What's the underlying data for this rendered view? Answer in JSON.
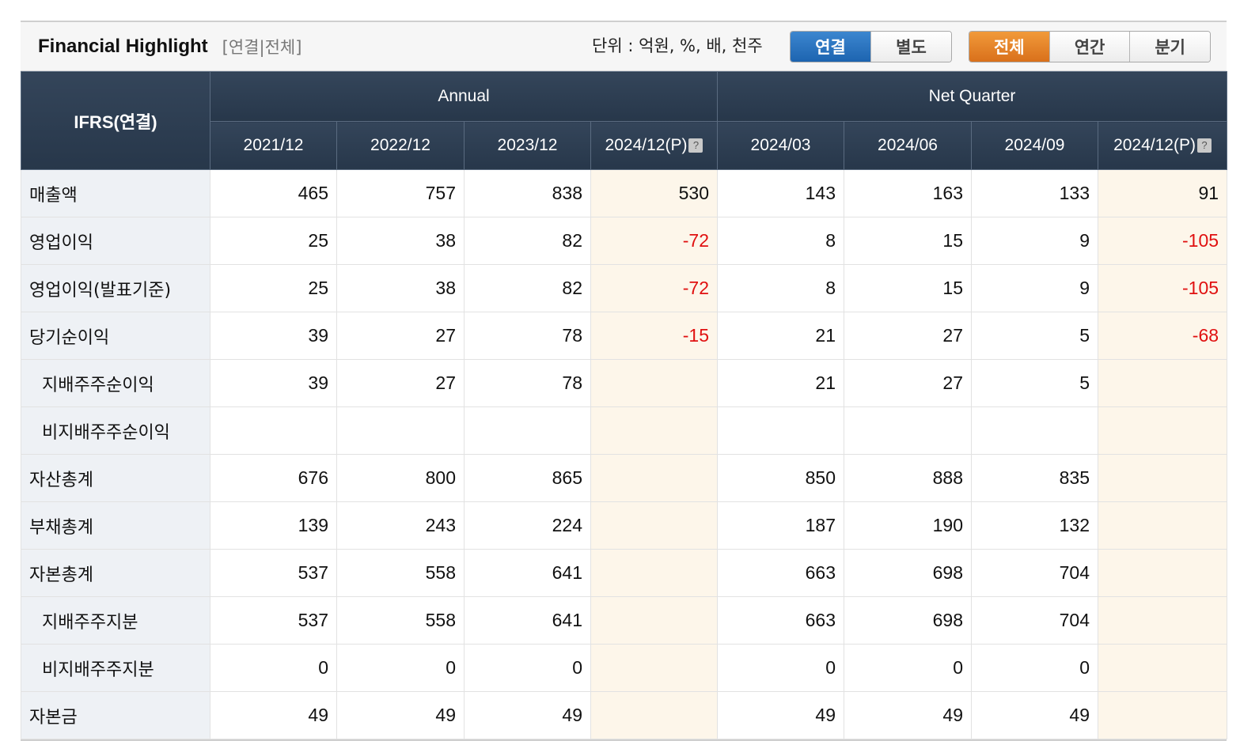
{
  "header": {
    "title": "Financial Highlight",
    "subtitle": "[연결|전체]",
    "unit_label": "단위 : 억원, %, 배, 천주",
    "consolidation_buttons": [
      "연결",
      "별도"
    ],
    "period_buttons": [
      "전체",
      "연간",
      "분기"
    ],
    "active_consolidation": "연결",
    "active_period": "전체",
    "colors": {
      "active_blue": "#1d64b0",
      "active_orange": "#d9701b",
      "header_bg": "#2c3d52",
      "negative": "#e01010",
      "estimate_bg": "#fdf6ea"
    }
  },
  "table": {
    "corner_label": "IFRS(연결)",
    "group_labels": [
      "Annual",
      "Net Quarter"
    ],
    "columns": [
      "2021/12",
      "2022/12",
      "2023/12",
      "2024/12(P)",
      "2024/03",
      "2024/06",
      "2024/09",
      "2024/12(P)"
    ],
    "help_icon": "?",
    "rows": [
      {
        "label": "매출액",
        "values": [
          "465",
          "757",
          "838",
          "530",
          "143",
          "163",
          "133",
          "91"
        ]
      },
      {
        "label": "영업이익",
        "values": [
          "25",
          "38",
          "82",
          "-72",
          "8",
          "15",
          "9",
          "-105"
        ]
      },
      {
        "label": "영업이익(발표기준)",
        "values": [
          "25",
          "38",
          "82",
          "-72",
          "8",
          "15",
          "9",
          "-105"
        ]
      },
      {
        "label": "당기순이익",
        "values": [
          "39",
          "27",
          "78",
          "-15",
          "21",
          "27",
          "5",
          "-68"
        ]
      },
      {
        "label": "지배주주순이익",
        "values": [
          "39",
          "27",
          "78",
          "",
          "21",
          "27",
          "5",
          ""
        ]
      },
      {
        "label": "비지배주주순이익",
        "values": [
          "",
          "",
          "",
          "",
          "",
          "",
          "",
          ""
        ]
      },
      {
        "label": "자산총계",
        "values": [
          "676",
          "800",
          "865",
          "",
          "850",
          "888",
          "835",
          ""
        ]
      },
      {
        "label": "부채총계",
        "values": [
          "139",
          "243",
          "224",
          "",
          "187",
          "190",
          "132",
          ""
        ]
      },
      {
        "label": "자본총계",
        "values": [
          "537",
          "558",
          "641",
          "",
          "663",
          "698",
          "704",
          ""
        ]
      },
      {
        "label": "지배주주지분",
        "values": [
          "537",
          "558",
          "641",
          "",
          "663",
          "698",
          "704",
          ""
        ]
      },
      {
        "label": "비지배주주지분",
        "values": [
          "0",
          "0",
          "0",
          "",
          "0",
          "0",
          "0",
          ""
        ]
      },
      {
        "label": "자본금",
        "values": [
          "49",
          "49",
          "49",
          "",
          "49",
          "49",
          "49",
          ""
        ]
      }
    ]
  }
}
